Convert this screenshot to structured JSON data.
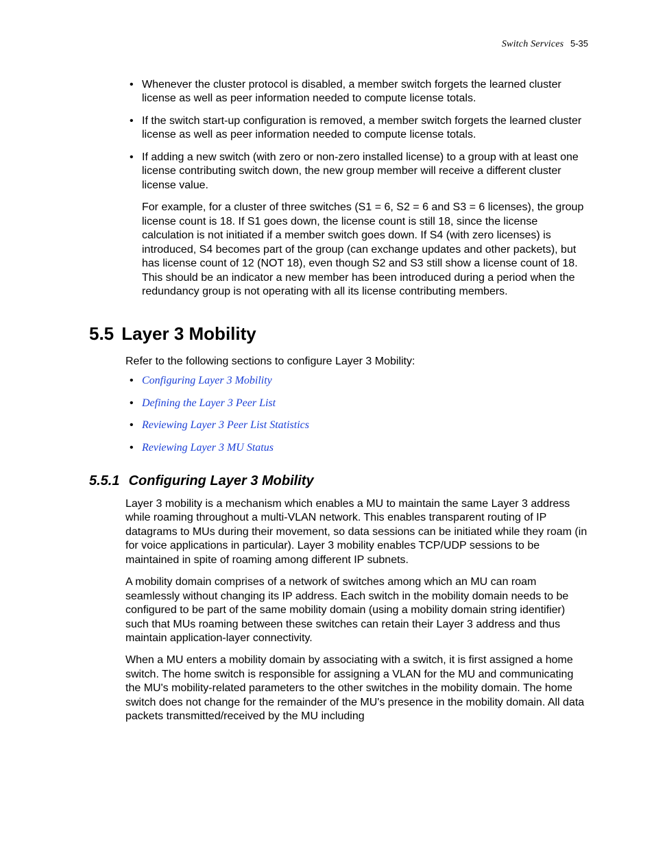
{
  "header": {
    "doc_section": "Switch Services",
    "page_number": "5-35"
  },
  "top_bullets": [
    {
      "text": "Whenever the cluster protocol is disabled, a member switch forgets the learned cluster license as well as peer information needed to compute license totals."
    },
    {
      "text": "If the switch start-up configuration is removed, a member switch forgets the learned cluster license as well as peer information needed to compute license totals."
    },
    {
      "text": "If adding a new switch (with zero or non-zero installed license) to a group with at least one license contributing switch down, the new group member will receive a different cluster license value.",
      "example": "For example, for a cluster of three switches (S1 = 6, S2 = 6 and S3 = 6 licenses), the group license count is 18. If S1 goes down, the license count is still 18, since the license calculation is not initiated if a member switch goes down. If S4 (with zero licenses) is introduced, S4 becomes part of the group (can exchange updates and other packets), but has license count of 12 (NOT 18), even though S2 and S3 still show a license count of 18. This should be an indicator a new member has been introduced during a period when the redundancy group is not operating with all its license contributing members."
    }
  ],
  "section": {
    "number": "5.5",
    "title": "Layer 3 Mobility",
    "intro": "Refer to the following sections to configure Layer 3 Mobility:",
    "links": [
      "Configuring Layer 3 Mobility",
      "Defining the Layer 3 Peer List",
      "Reviewing Layer 3 Peer List Statistics",
      "Reviewing Layer 3 MU Status"
    ]
  },
  "subsection": {
    "number": "5.5.1",
    "title": "Configuring Layer 3 Mobility",
    "paragraphs": [
      "Layer 3 mobility is a mechanism which enables a MU to maintain the same Layer 3 address while roaming throughout a multi-VLAN network. This enables transparent routing of IP datagrams to MUs during their movement, so data sessions can be initiated while they roam (in for voice applications in particular). Layer 3 mobility enables TCP/UDP sessions to be maintained in spite of roaming among different IP subnets.",
      "A mobility domain comprises of a network of switches among which an MU can roam seamlessly without changing its IP address. Each switch in the mobility domain needs to be configured to be part of the same mobility domain (using a mobility domain string identifier) such that MUs roaming between these switches can retain their Layer 3 address and thus maintain application-layer connectivity.",
      "When a MU enters a mobility domain by associating with a switch, it is first assigned a home switch. The home switch is responsible for assigning a VLAN for the MU and communicating the MU's mobility-related parameters to the other switches in the mobility domain. The home switch does not change for the remainder of the MU's presence in the mobility domain. All data packets transmitted/received by the MU including"
    ]
  }
}
